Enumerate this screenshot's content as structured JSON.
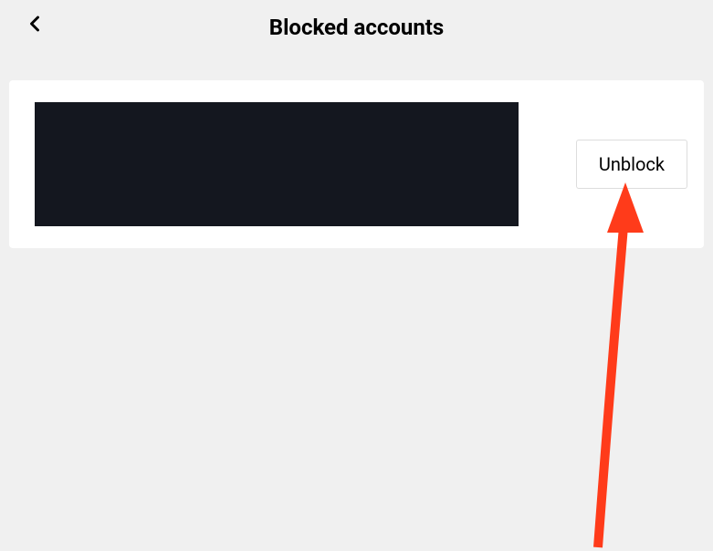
{
  "header": {
    "title": "Blocked accounts"
  },
  "list": {
    "items": [
      {
        "unblock_label": "Unblock"
      }
    ]
  },
  "annotation": {
    "arrow_color": "#ff3b1a"
  }
}
